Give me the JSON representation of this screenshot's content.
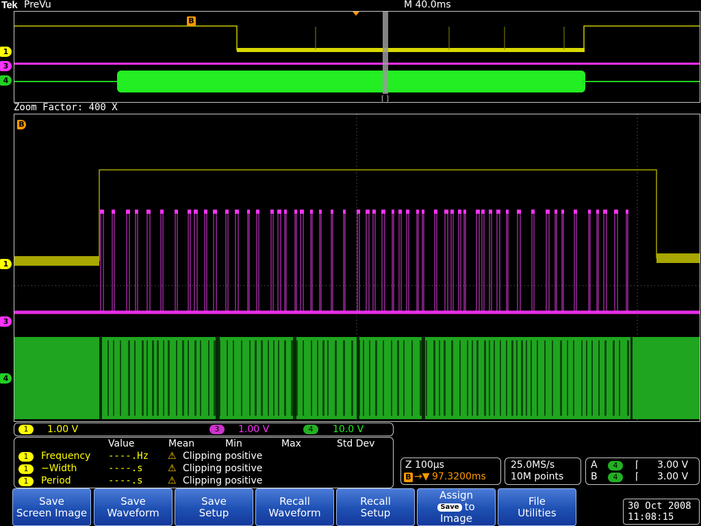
{
  "topbar": {
    "logo": "Tek",
    "title": "PreVu",
    "timebase": "M 40.0ms"
  },
  "overview": {
    "trigger_marker": "B",
    "channel_tags": [
      "1",
      "3",
      "4"
    ]
  },
  "zoom": {
    "label": "Zoom Factor: 400 X",
    "trigger_marker": "B",
    "channel_tags": [
      "1",
      "3",
      "4"
    ]
  },
  "scale_bar": {
    "ch1_badge": "1",
    "ch1_scale": "1.00 V",
    "ch3_badge": "3",
    "ch3_scale": "1.00 V",
    "ch4_badge": "4",
    "ch4_scale": "10.0 V"
  },
  "measurements": {
    "headers": [
      "Value",
      "Mean",
      "Min",
      "Max",
      "Std Dev"
    ],
    "rows": [
      {
        "badge": "1",
        "label": "Frequency",
        "value": "----.Hz",
        "warning": "Clipping positive"
      },
      {
        "badge": "1",
        "label": "−Width",
        "value": "----.s",
        "warning": "Clipping positive"
      },
      {
        "badge": "1",
        "label": "Period",
        "value": "----.s",
        "warning": "Clipping positive"
      }
    ]
  },
  "zoom_info": {
    "zoom_scale": "Z 100µs",
    "trigger_badge": "B",
    "trigger_pos": "97.3200ms"
  },
  "acquisition": {
    "sample_rate": "25.0MS/s",
    "record_length": "10M points"
  },
  "trigger_info": {
    "a_label": "A",
    "a_source": "4",
    "a_level": "3.00 V",
    "b_label": "B",
    "b_source": "4",
    "b_level": "3.00 V"
  },
  "softkeys": [
    {
      "line1": "Save",
      "line2": "Screen Image"
    },
    {
      "line1": "Save",
      "line2": "Waveform"
    },
    {
      "line1": "Save",
      "line2": "Setup"
    },
    {
      "line1": "Recall",
      "line2": "Waveform"
    },
    {
      "line1": "Recall",
      "line2": "Setup"
    },
    {
      "line1": "Assign",
      "badge": "Save",
      "line2": "to",
      "line3": "Image"
    },
    {
      "line1": "File",
      "line2": "Utilities"
    }
  ],
  "datetime": {
    "date": "30 Oct  2008",
    "time": "11:08:15"
  },
  "colors": {
    "ch1": "#ffff00",
    "ch3": "#ff33ff",
    "ch4": "#22d022",
    "softkey": "#2a5cc4",
    "trigger": "#ff9900"
  }
}
